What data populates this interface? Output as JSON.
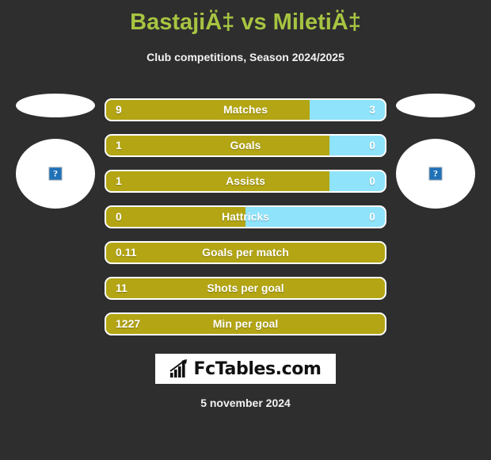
{
  "header": {
    "title": "BastajiÄ‡ vs MiletiÄ‡",
    "subtitle": "Club competitions, Season 2024/2025"
  },
  "colors": {
    "background": "#2e2e2e",
    "title": "#a7c441",
    "home_bar": "#b3a513",
    "away_bar": "#8fe3fb",
    "text": "#ffffff",
    "oval": "#ffffff",
    "placeholder_icon": "#1f71b8"
  },
  "players": {
    "home": {
      "flag_icon": "flag-placeholder-oval",
      "photo_icon": "broken-image-icon",
      "photo_glyph": "?"
    },
    "away": {
      "flag_icon": "flag-placeholder-oval",
      "photo_icon": "broken-image-icon",
      "photo_glyph": "?"
    }
  },
  "stats": [
    {
      "label": "Matches",
      "home": "9",
      "away": "3",
      "home_pct": 73,
      "dual": true
    },
    {
      "label": "Goals",
      "home": "1",
      "away": "0",
      "home_pct": 80,
      "dual": true
    },
    {
      "label": "Assists",
      "home": "1",
      "away": "0",
      "home_pct": 80,
      "dual": true
    },
    {
      "label": "Hattricks",
      "home": "0",
      "away": "0",
      "home_pct": 50,
      "dual": true
    },
    {
      "label": "Goals per match",
      "home": "0.11",
      "away": "",
      "home_pct": 100,
      "dual": false
    },
    {
      "label": "Shots per goal",
      "home": "11",
      "away": "",
      "home_pct": 100,
      "dual": false
    },
    {
      "label": "Min per goal",
      "home": "1227",
      "away": "",
      "home_pct": 100,
      "dual": false
    }
  ],
  "footer": {
    "logo_text": "FcTables.com",
    "logo_icon": "bar-chart-arrow-icon",
    "date": "5 november 2024"
  }
}
